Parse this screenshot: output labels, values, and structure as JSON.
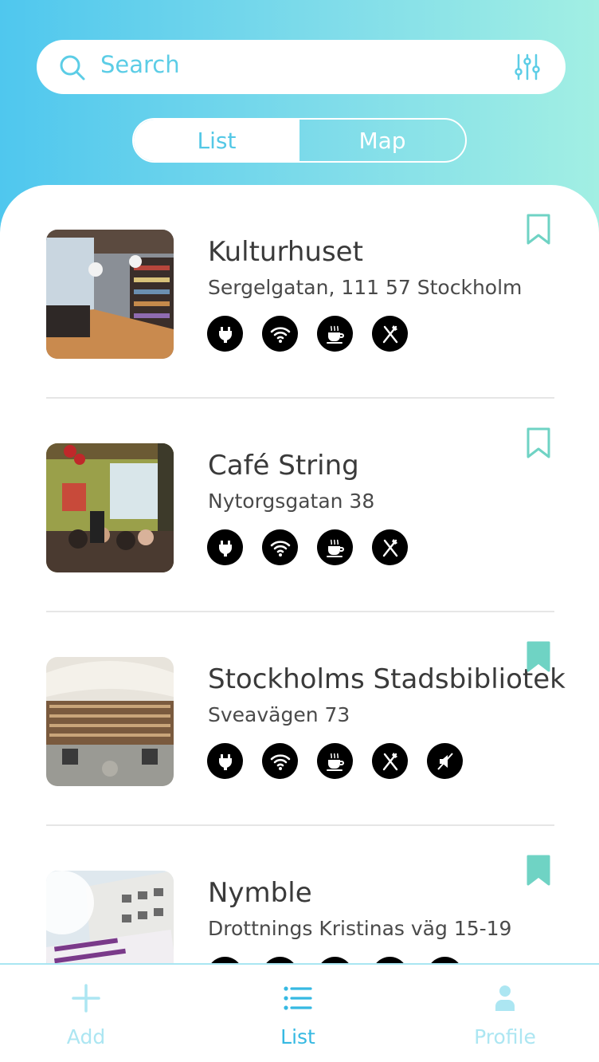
{
  "search": {
    "placeholder": "Search"
  },
  "view_toggle": {
    "list_label": "List",
    "map_label": "Map",
    "selected": "List"
  },
  "places": [
    {
      "name": "Kulturhuset",
      "address": "Sergelgatan, 111 57 Stockholm",
      "bookmarked": false,
      "amenities": [
        "power-outlet-icon",
        "wifi-icon",
        "coffee-icon",
        "food-icon"
      ]
    },
    {
      "name": "Café String",
      "address": "Nytorgsgatan 38",
      "bookmarked": false,
      "amenities": [
        "power-outlet-icon",
        "wifi-icon",
        "coffee-icon",
        "food-icon"
      ]
    },
    {
      "name": "Stockholms Stadsbibliotek",
      "address": "Sveavägen 73",
      "bookmarked": true,
      "amenities": [
        "power-outlet-icon",
        "wifi-icon",
        "coffee-icon",
        "food-icon",
        "quiet-icon"
      ]
    },
    {
      "name": "Nymble",
      "address": "Drottnings Kristinas väg 15-19",
      "bookmarked": true,
      "amenities": [
        "power-outlet-icon",
        "wifi-icon",
        "coffee-icon",
        "food-icon",
        "quiet-icon"
      ]
    }
  ],
  "bottom_nav": {
    "add_label": "Add",
    "list_label": "List",
    "profile_label": "Profile",
    "active": "List"
  },
  "colors": {
    "accent": "#4fc7ee",
    "bookmark": "#6fd3c4",
    "tab_inactive": "#ace6f2",
    "tab_active": "#36b9e2"
  }
}
